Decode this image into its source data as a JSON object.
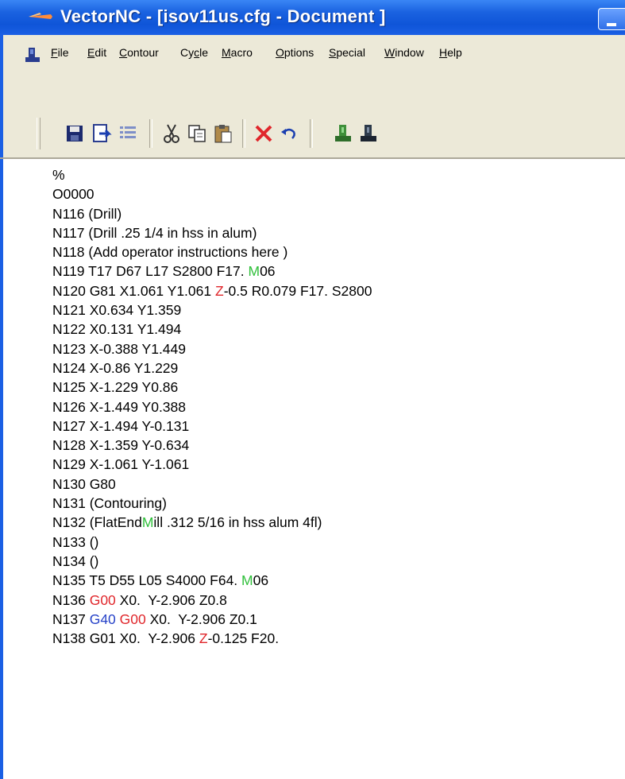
{
  "window": {
    "title": "VectorNC - [isov11us.cfg - Document ]"
  },
  "menu": [
    {
      "pre": "",
      "u": "F",
      "post": "ile"
    },
    {
      "pre": "",
      "u": "E",
      "post": "dit"
    },
    {
      "pre": "",
      "u": "C",
      "post": "ontour"
    },
    {
      "pre": "Cy",
      "u": "c",
      "post": "le"
    },
    {
      "pre": "",
      "u": "M",
      "post": "acro"
    },
    {
      "pre": "",
      "u": "O",
      "post": "ptions"
    },
    {
      "pre": "",
      "u": "S",
      "post": "pecial"
    },
    {
      "pre": "",
      "u": "W",
      "post": "indow"
    },
    {
      "pre": "",
      "u": "H",
      "post": "elp"
    }
  ],
  "toolbar": {
    "buttons": [
      "save-icon",
      "export-icon",
      "list-icon",
      "cut-icon",
      "copy-icon",
      "paste-icon",
      "delete-icon",
      "undo-icon",
      "machine-green-icon",
      "machine-dark-icon"
    ]
  },
  "colors": {
    "title_blue": "#1a5fe4",
    "chrome": "#ece9d8",
    "token_red": "#e0262b",
    "token_green": "#2fbf3a",
    "token_blue": "#2642c8"
  },
  "code_lines": [
    [
      {
        "t": "%"
      }
    ],
    [
      {
        "t": "O0000"
      }
    ],
    [
      {
        "t": "N116 (Drill)"
      }
    ],
    [
      {
        "t": "N117 (Drill .25 1/4 in hss in alum)"
      }
    ],
    [
      {
        "t": "N118 (Add operator instructions here )"
      }
    ],
    [
      {
        "t": "N119 T17 D67 L17 S2800 F17. "
      },
      {
        "t": "M",
        "c": "green"
      },
      {
        "t": "06"
      }
    ],
    [
      {
        "t": "N120 G81 X1.061 Y1.061 "
      },
      {
        "t": "Z",
        "c": "red"
      },
      {
        "t": "-0.5 R0.079 F17. S2800"
      }
    ],
    [
      {
        "t": "N121 X0.634 Y1.359"
      }
    ],
    [
      {
        "t": "N122 X0.131 Y1.494"
      }
    ],
    [
      {
        "t": "N123 X-0.388 Y1.449"
      }
    ],
    [
      {
        "t": "N124 X-0.86 Y1.229"
      }
    ],
    [
      {
        "t": "N125 X-1.229 Y0.86"
      }
    ],
    [
      {
        "t": "N126 X-1.449 Y0.388"
      }
    ],
    [
      {
        "t": "N127 X-1.494 Y-0.131"
      }
    ],
    [
      {
        "t": "N128 X-1.359 Y-0.634"
      }
    ],
    [
      {
        "t": "N129 X-1.061 Y-1.061"
      }
    ],
    [
      {
        "t": "N130 G80"
      }
    ],
    [
      {
        "t": "N131 (Contouring)"
      }
    ],
    [
      {
        "t": "N132 (FlatEnd"
      },
      {
        "t": "M",
        "c": "green"
      },
      {
        "t": "ill .312 5/16 in hss alum 4fl)"
      }
    ],
    [
      {
        "t": "N133 ()"
      }
    ],
    [
      {
        "t": "N134 ()"
      }
    ],
    [
      {
        "t": "N135 T5 D55 L05 S4000 F64. "
      },
      {
        "t": "M",
        "c": "green"
      },
      {
        "t": "06"
      }
    ],
    [
      {
        "t": "N136 "
      },
      {
        "t": "G00",
        "c": "red"
      },
      {
        "t": " X0.  Y-2.906 Z0.8"
      }
    ],
    [
      {
        "t": "N137 "
      },
      {
        "t": "G40",
        "c": "blue"
      },
      {
        "t": " "
      },
      {
        "t": "G00",
        "c": "red"
      },
      {
        "t": " X0.  Y-2.906 Z0.1"
      }
    ],
    [
      {
        "t": "N138 G01 X0.  Y-2.906 "
      },
      {
        "t": "Z",
        "c": "red"
      },
      {
        "t": "-0.125 F20."
      }
    ]
  ]
}
